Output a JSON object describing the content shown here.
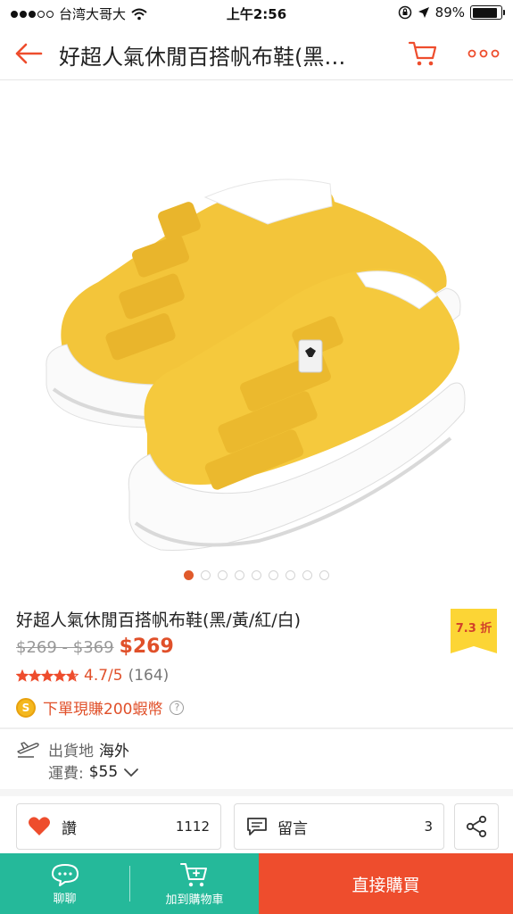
{
  "status_bar": {
    "carrier": "台湾大哥大",
    "time": "上午2:56",
    "battery": "89%",
    "battery_level": 0.89
  },
  "header": {
    "title": "好超人氣休閒百搭帆布鞋(黑…"
  },
  "gallery": {
    "image_count": 9,
    "active_index": 0
  },
  "product": {
    "title": "好超人氣休閒百搭帆布鞋(黑/黃/紅/白)",
    "discount": "7.3 折",
    "price_original": "$269 - $369",
    "price_current": "$269",
    "rating_stars": 4.7,
    "rating_score": "4.7/5",
    "rating_count": "(164)",
    "coin_text": "下單現賺200蝦幣"
  },
  "shipping": {
    "origin_label": "出貨地",
    "origin_value": "海外",
    "fee_label": "運費:",
    "fee_value": "$55"
  },
  "actions": {
    "like_label": "讚",
    "like_count": "1112",
    "comment_label": "留言",
    "comment_count": "3"
  },
  "bottom_bar": {
    "chat_label": "聊聊",
    "add_cart_label": "加到購物車",
    "buy_label": "直接購買"
  },
  "colors": {
    "accent": "#ee4d2d",
    "teal": "#25b99a",
    "badge_yellow": "#fcd535"
  }
}
